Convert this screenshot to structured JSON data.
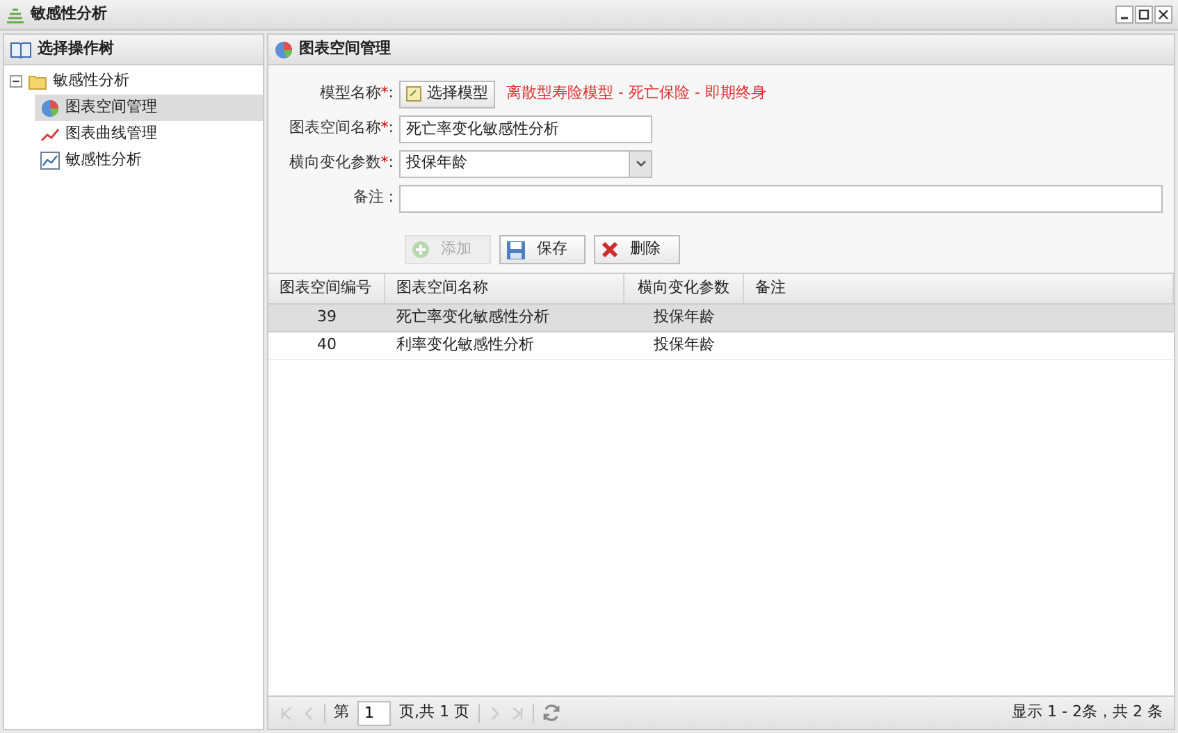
{
  "window": {
    "title": "敏感性分析"
  },
  "sidebar": {
    "title": "选择操作树",
    "tree": [
      {
        "label": "敏感性分析",
        "kind": "folder",
        "expanded": true,
        "selected": false,
        "children": [
          {
            "label": "图表空间管理",
            "kind": "pie",
            "selected": true
          },
          {
            "label": "图表曲线管理",
            "kind": "curve",
            "selected": false
          },
          {
            "label": "敏感性分析",
            "kind": "chart",
            "selected": false
          }
        ]
      }
    ]
  },
  "panel": {
    "title": "图表空间管理"
  },
  "form": {
    "model_label": "模型名称",
    "model_button": "选择模型",
    "model_value": "离散型寿险模型 - 死亡保险 - 即期终身",
    "name_label": "图表空间名称",
    "name_value": "死亡率变化敏感性分析",
    "param_label": "横向变化参数",
    "param_value": "投保年龄",
    "note_label": "备注",
    "required_mark": "*",
    "label_suffix": ":"
  },
  "actions": [
    {
      "label": "添加",
      "kind": "add",
      "disabled": true
    },
    {
      "label": "保存",
      "kind": "save",
      "disabled": false
    },
    {
      "label": "删除",
      "kind": "delete",
      "disabled": false
    }
  ],
  "table": {
    "columns": [
      "图表空间编号",
      "图表空间名称",
      "横向变化参数",
      "备注"
    ],
    "rows": [
      {
        "cells": [
          "39",
          "死亡率变化敏感性分析",
          "投保年龄"
        ],
        "selected": true
      },
      {
        "cells": [
          "40",
          "利率变化敏感性分析",
          "投保年龄"
        ],
        "selected": false
      }
    ]
  },
  "pager": {
    "page_prefix": "第",
    "page": "1",
    "page_suffix": "页,共 1 页",
    "summary": "显示 1 - 2条，共 2 条"
  }
}
